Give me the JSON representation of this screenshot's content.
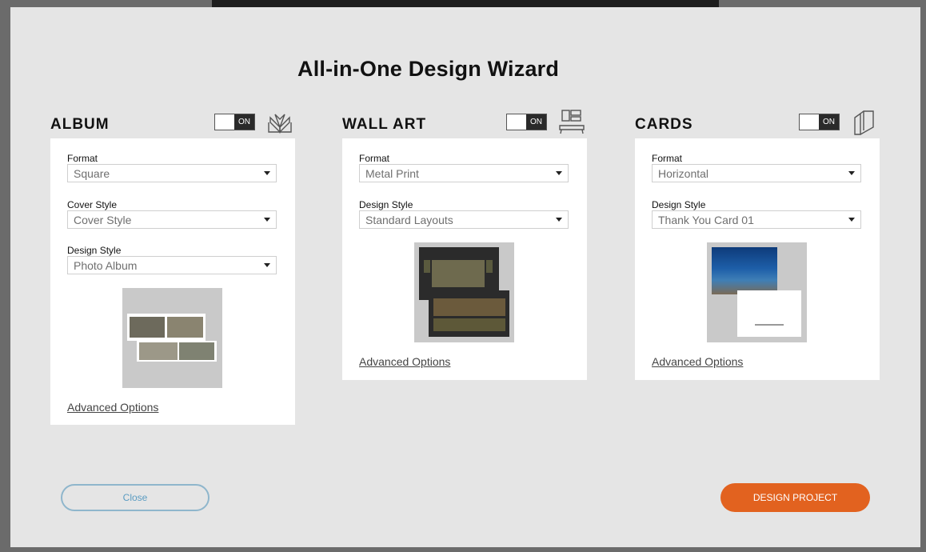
{
  "title": "All-in-One Design Wizard",
  "sections": {
    "album": {
      "heading": "ALBUM",
      "toggle_label": "ON",
      "icon": "open-book-icon",
      "format_label": "Format",
      "format_value": "Square",
      "cover_label": "Cover Style",
      "cover_value": "Cover Style",
      "design_label": "Design Style",
      "design_value": "Photo Album",
      "advanced": "Advanced Options"
    },
    "wall_art": {
      "heading": "WALL ART",
      "toggle_label": "ON",
      "icon": "wall-art-furniture-icon",
      "format_label": "Format",
      "format_value": "Metal Print",
      "design_label": "Design Style",
      "design_value": "Standard Layouts",
      "advanced": "Advanced Options"
    },
    "cards": {
      "heading": "CARDS",
      "toggle_label": "ON",
      "icon": "cards-stack-icon",
      "format_label": "Format",
      "format_value": "Horizontal",
      "design_label": "Design Style",
      "design_value": "Thank You Card 01",
      "advanced": "Advanced Options"
    }
  },
  "buttons": {
    "close": "Close",
    "design_project": "DESIGN PROJECT"
  },
  "colors": {
    "accent": "#e2621f",
    "close_border": "#8fb6cc",
    "dialog_bg": "#e5e5e5"
  }
}
